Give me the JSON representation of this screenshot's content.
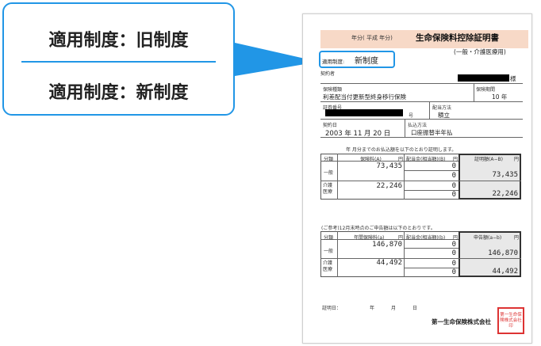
{
  "callout": {
    "old_system": "適用制度：旧制度",
    "new_system": "適用制度：新制度"
  },
  "doc": {
    "title_prefix": "年分(  平成     年分)",
    "title": "生命保険料控除証明書",
    "subtitle": "(一般・介護医療用)",
    "system_label": "適用制度:",
    "system_value": "新制度",
    "contractor_label": "契約者",
    "honorific": "様",
    "insurance_type_label": "保険種類",
    "insurance_type_value": "利差配当付更新型終身移行保険",
    "period_label": "保険期間",
    "period_value": "10 年",
    "policy_no_label": "証券番号",
    "policy_no_suffix": "号",
    "dividend_method_label": "配当方法",
    "dividend_method_value": "積立",
    "contract_date_label": "契約日",
    "contract_date_value": "2003 年 11 月 20 日",
    "payment_method_label": "払込方法",
    "payment_method_value": "口座振替半年払",
    "paid_caption": "年    月分までのお払込額を以下のとおり証明します。",
    "table1": {
      "col_kind": "分類",
      "col_premium": "保険料(A)",
      "col_dividend": "配当金(相当額)(B)",
      "col_proof": "証明額(A−B)",
      "unit": "円",
      "rows": [
        {
          "kind": "一般",
          "premium": "73,435",
          "dividend_a": "0",
          "dividend_b": "0",
          "proof": "73,435"
        },
        {
          "kind": "介護医療",
          "premium": "22,246",
          "dividend_a": "0",
          "dividend_b": "0",
          "proof": "22,246"
        }
      ]
    },
    "ref_caption": "(ご参考)12月末時点のご申告額は以下のとおりです。",
    "table2": {
      "col_kind": "分類",
      "col_premium": "年間保険料(a)",
      "col_dividend": "配当金(相当額)(b)",
      "col_declare": "申告額(a−b)",
      "unit": "円",
      "rows": [
        {
          "kind": "一般",
          "premium": "146,870",
          "dividend_a": "0",
          "dividend_b": "0",
          "declare": "146,870"
        },
        {
          "kind": "介護医療",
          "premium": "44,492",
          "dividend_a": "0",
          "dividend_b": "0",
          "declare": "44,492"
        }
      ]
    },
    "cert_date_label": "証明日：",
    "cert_date_parts": [
      "年",
      "月",
      "日"
    ],
    "company": "第一生命保険株式会社",
    "seal_text": "第一生命保険株式会社印"
  }
}
